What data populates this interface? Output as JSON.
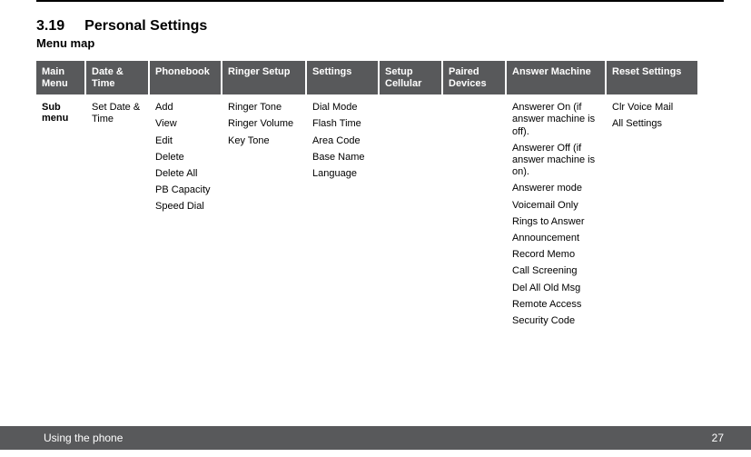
{
  "section": {
    "number": "3.19",
    "title": "Personal Settings",
    "subtitle": "Menu map"
  },
  "table": {
    "headers": [
      "Main Menu",
      "Date & Time",
      "Phonebook",
      "Ringer Setup",
      "Settings",
      "Setup Cellular",
      "Paired Devices",
      "Answer Machine",
      "Reset Settings"
    ],
    "row_label": "Sub menu",
    "cols": {
      "date_time": [
        "Set Date & Time"
      ],
      "phonebook": [
        "Add",
        "View",
        "Edit",
        "Delete",
        "Delete All",
        "PB Capacity",
        "Speed Dial"
      ],
      "ringer_setup": [
        "Ringer Tone",
        "Ringer Volume",
        "Key Tone"
      ],
      "settings": [
        "Dial Mode",
        "Flash Time",
        "Area Code",
        "Base Name",
        "Language"
      ],
      "setup_cellular": [],
      "paired_devices": [],
      "answer_machine": [
        "Answerer On (if answer machine is off).",
        "Answerer Off (if answer machine is on).",
        "Answerer mode",
        "Voicemail Only",
        "Rings to Answer",
        "Announcement",
        "Record Memo",
        "Call Screening",
        "Del All Old Msg",
        "Remote Access",
        "Security Code"
      ],
      "reset_settings": [
        "Clr Voice Mail",
        "All Settings"
      ]
    }
  },
  "footer": {
    "left": "Using the phone",
    "right": "27"
  }
}
